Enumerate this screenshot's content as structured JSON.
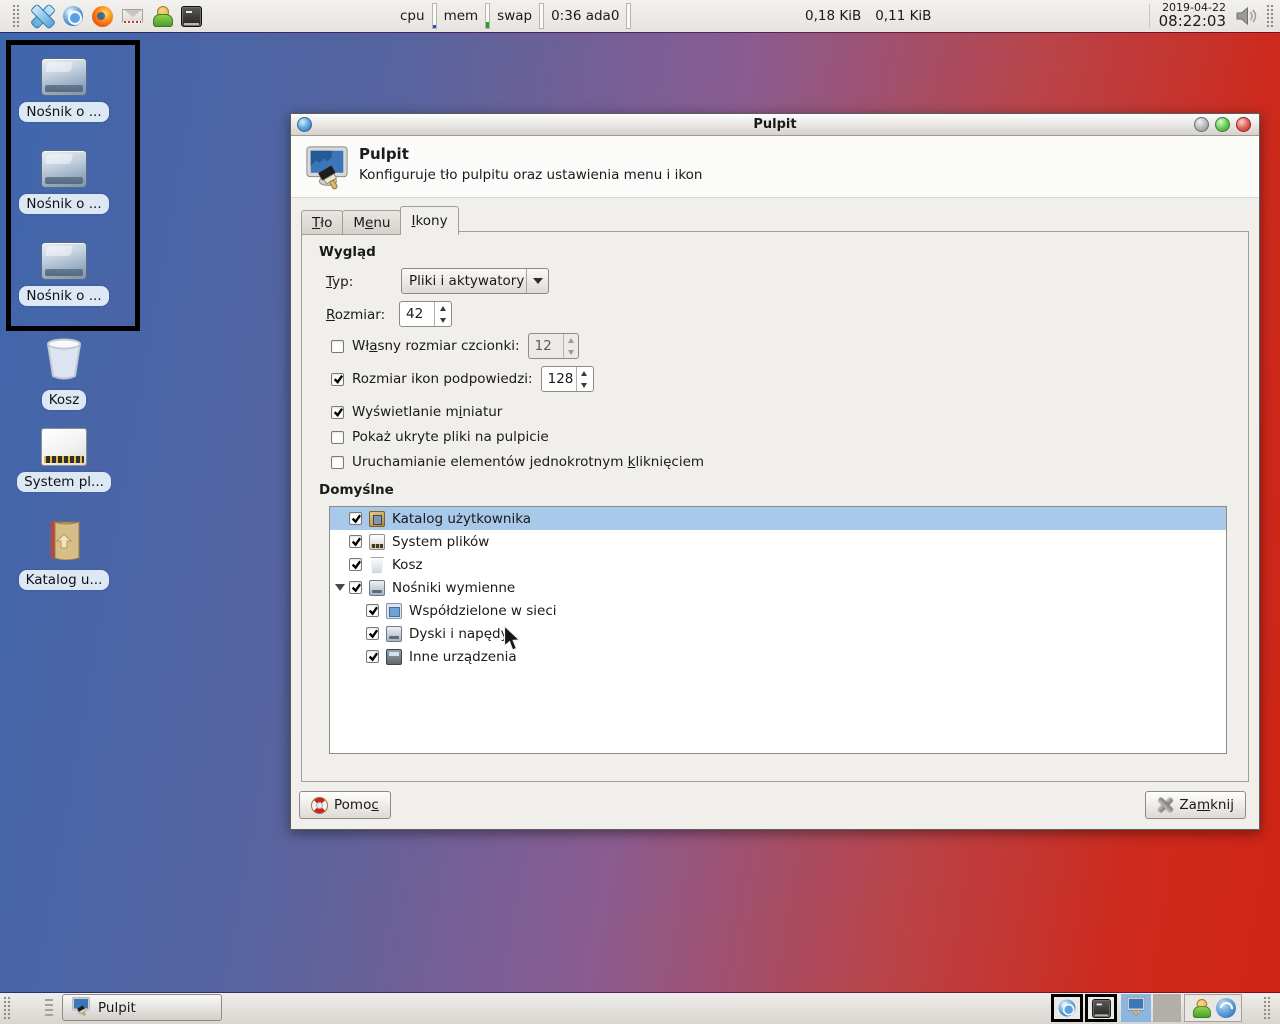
{
  "panel": {
    "launcher_icons": [
      "xfce-menu",
      "chromium",
      "firefox",
      "mail",
      "user-switch",
      "terminal"
    ],
    "monitors": [
      {
        "label": "cpu"
      },
      {
        "label": "mem"
      },
      {
        "label": "swap"
      },
      {
        "label": "0:36 ada0"
      }
    ],
    "network": {
      "value_down": "0,18 KiB",
      "value_up": "0,11 KiB"
    },
    "clock": {
      "date": "2019-04-22",
      "time": "08:22:03"
    }
  },
  "desktop": {
    "icons": [
      {
        "label": "Nośnik o ...",
        "type": "removable-drive"
      },
      {
        "label": "Nośnik o ...",
        "type": "removable-drive"
      },
      {
        "label": "Nośnik o ...",
        "type": "removable-drive"
      },
      {
        "label": "Kosz",
        "type": "trash"
      },
      {
        "label": "System pl...",
        "type": "filesystem"
      },
      {
        "label": "Katalog u...",
        "type": "home-folder"
      }
    ],
    "colors": {
      "gradient_left": "#3f66ae",
      "gradient_right": "#d02415",
      "annotation": "#000000"
    }
  },
  "dialog": {
    "title": "Pulpit",
    "header_title": "Pulpit",
    "header_subtitle": "Konfiguruje tło pulpitu oraz ustawienia menu i ikon",
    "tabs": [
      {
        "label": "[T]ło",
        "active": false
      },
      {
        "label": "M[e]nu",
        "active": false
      },
      {
        "label": "[I]kony",
        "active": true
      }
    ],
    "appearance": {
      "section_title": "Wygląd",
      "type_label": "[T]yp:",
      "type_value": "Pliki i aktywatory",
      "size_label": "[R]ozmiar:",
      "size_value": "42",
      "checkboxes": [
        {
          "label": "Wł[a]sny rozmiar czcionki:",
          "checked": false,
          "value": "12",
          "value_enabled": false
        },
        {
          "label": "Rozmiar ikon podpowiedzi:",
          "checked": true,
          "value": "128",
          "value_enabled": true
        },
        {
          "label": "Wyświetlanie m[i]niatur",
          "checked": true
        },
        {
          "label": "Pokaż ukryte pliki na pulpicie",
          "checked": false
        },
        {
          "label": "Uruchamianie elementów jednokrotnym [k]liknięciem",
          "checked": false
        }
      ]
    },
    "defaults": {
      "section_title": "Domyślne",
      "rows": [
        {
          "label": "Katalog użytkownika",
          "checked": true,
          "selected": true,
          "depth": 0
        },
        {
          "label": "System plików",
          "checked": true,
          "selected": false,
          "depth": 0
        },
        {
          "label": "Kosz",
          "checked": true,
          "selected": false,
          "depth": 0
        },
        {
          "label": "Nośniki wymienne",
          "checked": true,
          "selected": false,
          "depth": 0,
          "expanded": true
        },
        {
          "label": "Współdzielone w sieci",
          "checked": true,
          "selected": false,
          "depth": 1
        },
        {
          "label": "Dyski i napędy",
          "checked": true,
          "selected": false,
          "depth": 1
        },
        {
          "label": "Inne urządzenia",
          "checked": true,
          "selected": false,
          "depth": 1
        }
      ],
      "selection_color": "#a8c9e9"
    },
    "help_button": "Pomo[c]",
    "close_button": "Za[m]knij"
  },
  "taskbar": {
    "task_button": "Pulpit",
    "tray_icons": [
      "chromium",
      "terminal",
      "desktop-settings",
      "empty",
      "user-switch",
      "thunderbird"
    ]
  }
}
